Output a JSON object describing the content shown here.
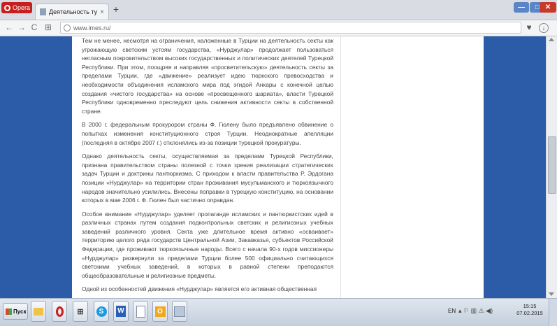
{
  "browser": {
    "app_label": "Opera",
    "tab_title": "Деятельность турецкой ре",
    "tab_close": "×",
    "new_tab": "+",
    "url": "www.imes.ru/",
    "window_controls": {
      "minimize": "—",
      "maximize": "□",
      "close": "✕"
    },
    "nav": {
      "back": "←",
      "forward": "→",
      "reload": "C",
      "speed_dial": "⊞",
      "heart": "♥",
      "download": "↓"
    }
  },
  "article": {
    "paragraphs": [
      "Тем не менее, несмотря на ограничения, наложенные в Турции на деятельность секты как угрожающую светским устоям государства, «Нурджулар» продолжает пользоваться негласным покровительством высоких государственных и политических деятелей Турецкой Республики. При этом, поощряя и направляя «просветительскую» деятельность секты за пределами Турции, где «движение» реализует идею тюркского превосходства и необходимости объединения исламского мира под эгидой Анкары с конечной целью создания «чистого государства» на основе «просвещенного шариата», власти Турецкой Республики одновременно преследуют цель снижения активности секты в собственной стране.",
      "В 2000 г. федеральным прокурором страны Ф. Гюлену было предъявлено обвинение о попытках изменения конституционного строя Турции. Неоднократные апелляции (последняя в октябре 2007 г.) отклонялись из-за позиции турецкой прокуратуры.",
      "Однако деятельность секты, осуществляемая за пределами Турецкой Республики, признана правительством страны полезной с точки зрения реализации стратегических задач Турции и доктрины пантюркизма. С приходом к власти правительства Р. Эрдогана позиции «Нурджулар» на территории стран проживания мусульманского и тюркоязычного народов значительно усилились. Внесены поправки в турецкую конституцию, на основании которых в мае 2006 г. Ф. Гюлен был частично оправдан.",
      "Особое внимание «Нурджулар» уделяет пропаганде исламских и пантюркистских идей в различных странах путем создания подконтрольных светских и религиозных учебных заведений различного уровня. Секта уже длительное время активно «осваивает» территорию целого ряда государств Центральной Азии, Закавказья, субъектов Российской Федерации, где проживают тюркоязычные народы. Всего с начала 90-х годов миссионеры «Нурджулар» развернули за пределами Турции более 500 официально считающихся светскими учебных заведений, в которых в равной степени преподаются общеобразовательные и религиозные предметы.",
      "Одной из особенностей движения «Нурджулар» является его активная общественная"
    ]
  },
  "taskbar": {
    "start_label": "Пуск",
    "apps": [
      "folder-icon",
      "opera-icon",
      "apps-grid-icon",
      "skype-icon",
      "word-icon",
      "document-icon",
      "outlook-icon",
      "window-icon"
    ],
    "app_glyphs": {
      "grid": "⊞",
      "skype": "S",
      "word": "W",
      "outlook": "O"
    },
    "language": "EN",
    "tray_icons": "▴ ⚐ ▥ ⚠ ◀)",
    "time": "15:15",
    "date": "07.02.2015"
  },
  "colors": {
    "page_background": "#2c5ba7",
    "opera_red": "#c61f1f"
  }
}
